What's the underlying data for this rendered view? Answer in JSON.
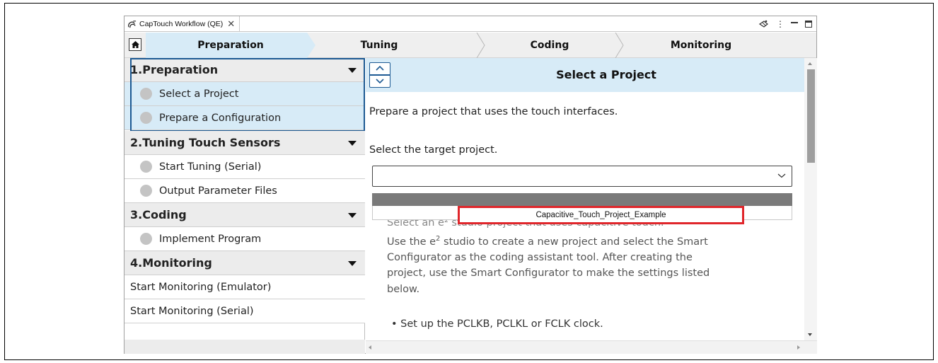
{
  "window": {
    "tab_title": "CapTouch Workflow (QE)",
    "tab_close": "✕"
  },
  "steps": [
    {
      "label": "Preparation",
      "active": true
    },
    {
      "label": "Tuning",
      "active": false
    },
    {
      "label": "Coding",
      "active": false
    },
    {
      "label": "Monitoring",
      "active": false
    }
  ],
  "sidebar": {
    "sections": [
      {
        "label": "1.Preparation",
        "items": [
          "Select a Project",
          "Prepare a Configuration"
        ]
      },
      {
        "label": "2.Tuning Touch Sensors",
        "items": [
          "Start Tuning (Serial)",
          "Output Parameter Files"
        ]
      },
      {
        "label": "3.Coding",
        "items": [
          "Implement Program"
        ]
      },
      {
        "label": "4.Monitoring",
        "items": [
          "Start Monitoring (Emulator)",
          "Start Monitoring (Serial)"
        ]
      }
    ]
  },
  "main": {
    "title": "Select a Project",
    "description": "Prepare a project that uses the touch interfaces.",
    "target_label": "Select the target project.",
    "combo_value": "",
    "dropdown_option": "Capacitive_Touch_Project_Example",
    "hidden_line": "Select an e² studio project that uses capacitive touch.",
    "body_line1_pre": "Use the e",
    "body_line1_sup": "2",
    "body_line1_post": " studio to create a new project and select the Smart",
    "body_line2": "Configurator as the coding assistant tool. After creating the",
    "body_line3": "project, use the Smart Configurator to make the settings listed",
    "body_line4": "below.",
    "bullet": "Set up the PCLKB, PCLKL or FCLK clock."
  },
  "colors": {
    "active_blue": "#d7ebf7",
    "border_blue": "#1d5a93",
    "highlight_red": "#e0262b"
  }
}
